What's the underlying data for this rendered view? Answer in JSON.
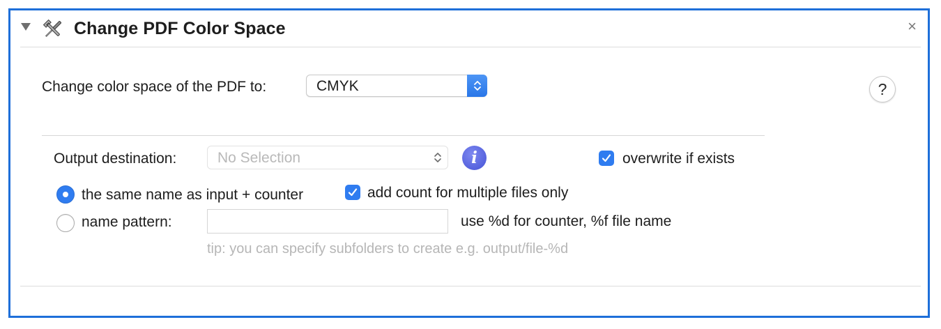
{
  "panel": {
    "title": "Change PDF Color Space",
    "close_glyph": "×",
    "accent_color": "#1e6fd9",
    "icons": {
      "disclosure": "disclosure-triangle-icon",
      "tools": "tools-icon",
      "close": "close-icon"
    }
  },
  "color_space": {
    "label": "Change color space of the PDF to:",
    "selected": "CMYK",
    "help_label": "?"
  },
  "output": {
    "label": "Output destination:",
    "destination_placeholder": "No Selection",
    "info_label": "i",
    "overwrite_label": "overwrite if exists",
    "overwrite_checked": true,
    "naming": {
      "option_same_label": "the same name as input + counter",
      "option_same_selected": true,
      "count_multiple_label": "add count for multiple files only",
      "count_multiple_checked": true,
      "option_pattern_label": "name pattern:",
      "option_pattern_selected": false,
      "pattern_value": "",
      "pattern_hint": "use %d for counter, %f file name",
      "tip": "tip: you can specify subfolders to create e.g. output/file-%d"
    }
  }
}
